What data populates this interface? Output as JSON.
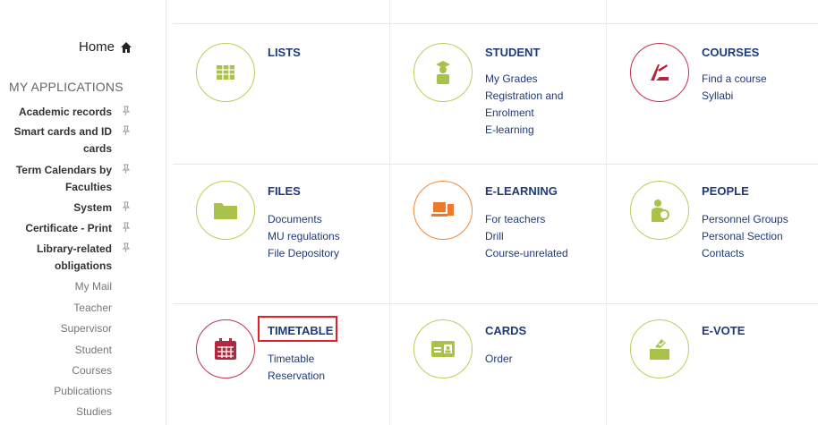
{
  "sidebar": {
    "home_label": "Home",
    "section_title": "MY APPLICATIONS",
    "pinned_items": [
      {
        "label": "Academic records"
      },
      {
        "label": "Smart cards and ID cards"
      },
      {
        "label": "Term Calendars by Faculties"
      },
      {
        "label": "System"
      },
      {
        "label": "Certificate - Print"
      },
      {
        "label": "Library-related obligations"
      }
    ],
    "plain_items": [
      "My Mail",
      "Teacher",
      "Supervisor",
      "Student",
      "Courses",
      "Publications",
      "Studies"
    ]
  },
  "tiles": [
    {
      "title": "LISTS",
      "icon": "table-icon",
      "links": []
    },
    {
      "title": "STUDENT",
      "icon": "graduate-icon",
      "links": [
        "My Grades",
        "Registration and",
        "Enrolment",
        "E-learning"
      ]
    },
    {
      "title": "COURSES",
      "icon": "compass-ruler-icon",
      "links": [
        "Find a course",
        "Syllabi"
      ]
    },
    {
      "title": "FILES",
      "icon": "folder-icon",
      "links": [
        "Documents",
        "MU regulations",
        "File Depository"
      ]
    },
    {
      "title": "E-LEARNING",
      "icon": "computer-icon",
      "links": [
        "For teachers",
        "Drill",
        "Course-unrelated"
      ]
    },
    {
      "title": "PEOPLE",
      "icon": "person-icon",
      "links": [
        "Personnel Groups",
        "Personal Section",
        "Contacts"
      ]
    },
    {
      "title": "TIMETABLE",
      "icon": "calendar-icon",
      "links": [
        "Timetable",
        "Reservation"
      ]
    },
    {
      "title": "CARDS",
      "icon": "id-card-icon",
      "links": [
        "Order"
      ]
    },
    {
      "title": "E-VOTE",
      "icon": "ballot-box-icon",
      "links": []
    }
  ],
  "colors": {
    "green": "#b9cf5a",
    "orange": "#ef8a3a",
    "red": "#c0334a",
    "link": "#1f3a7a",
    "highlight": "#e41f26"
  }
}
